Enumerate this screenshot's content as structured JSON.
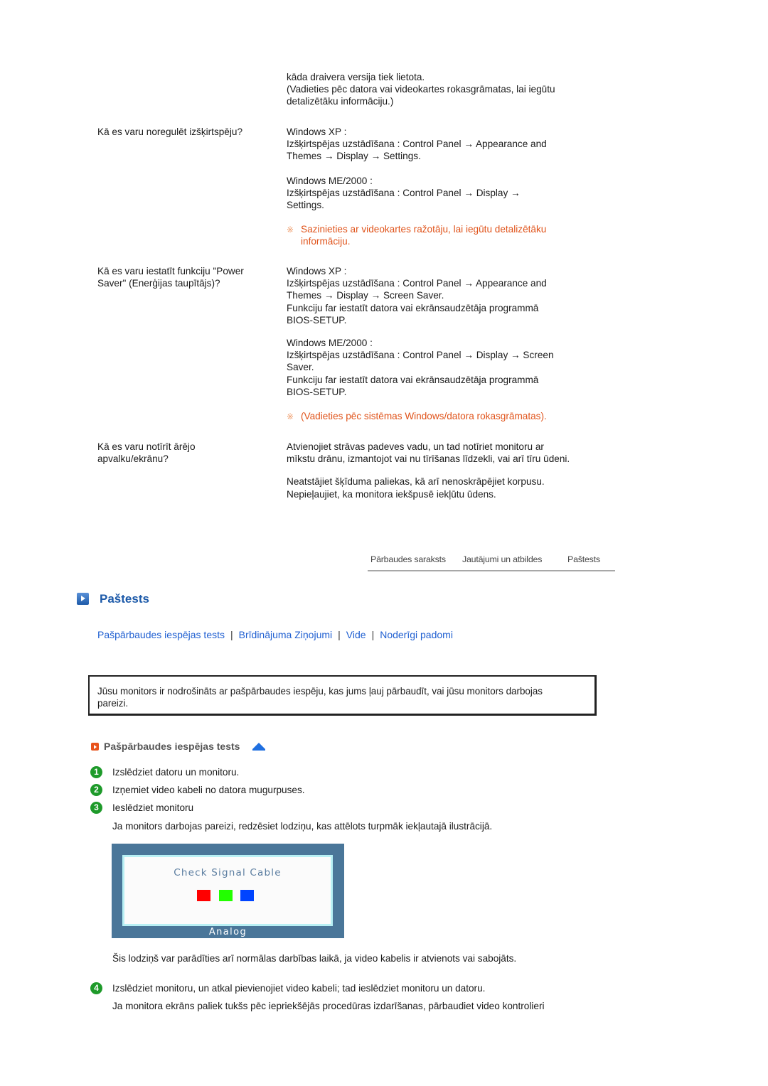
{
  "faq": {
    "intro_lines": [
      "kāda draivera versija tiek lietota.",
      "(Vadieties pēc datora vai videokartes rokasgrāmatas, lai iegūtu",
      "detalizētāku informāciju.)"
    ],
    "items": [
      {
        "question": "Kā es varu noregulēt izšķirtspēju?",
        "xp_label": "Windows XP :",
        "xp_lines": [
          "Izšķirtspējas uzstādīšana : Control Panel → Appearance and",
          "Themes → Display → Settings."
        ],
        "me_label": "Windows ME/2000 :",
        "me_lines": [
          "Izšķirtspējas uzstādīšana : Control Panel → Display →",
          "Settings."
        ],
        "note": "Sazinieties ar videokartes ražotāju, lai iegūtu detalizētāku informāciju."
      },
      {
        "question": "Kā es varu iestatīt funkciju \"Power Saver\" (Enerģijas taupītājs)?",
        "xp_label": "Windows XP :",
        "xp_lines": [
          "Izšķirtspējas uzstādīšana : Control Panel → Appearance and",
          "Themes → Display → Screen Saver.",
          "Funkciju far iestatīt datora vai ekrānsaudzētāja programmā",
          "BIOS-SETUP."
        ],
        "me_label": "Windows ME/2000 :",
        "me_lines": [
          "Izšķirtspējas uzstādīšana : Control Panel → Display → Screen",
          "Saver.",
          "Funkciju far iestatīt datora vai ekrānsaudzētāja programmā",
          "BIOS-SETUP."
        ],
        "note": "(Vadieties pēc sistēmas Windows/datora rokasgrāmatas)."
      },
      {
        "question": "Kā es varu notīrīt ārējo apvalku/ekrānu?",
        "answer_p1": "Atvienojiet strāvas padeves vadu, un tad notīriet monitoru ar mīkstu drānu, izmantojot vai nu tīrīšanas līdzekli, vai arī tīru ūdeni.",
        "answer_p2_lines": [
          "Neatstājiet šķīduma paliekas, kā arī nenoskrāpējiet korpusu.",
          "Nepieļaujiet, ka monitora iekšpusē iekļūtu ūdens."
        ]
      }
    ],
    "note_mark": "※"
  },
  "nav_tabs": [
    "Pārbaudes saraksts",
    "Jautājumi un atbildes",
    "Paštests"
  ],
  "section": {
    "title": "Paštests",
    "links": [
      "Pašpārbaudes iespējas tests",
      "Brīdinājuma Ziņojumi",
      "Vide",
      "Noderīgi padomi"
    ],
    "link_separator": "|",
    "info_text": "Jūsu monitors ir nodrošināts ar pašpārbaudes iespēju, kas jums ļauj pārbaudīt, vai jūsu monitors darbojas pareizi.",
    "subsection_title": "Pašpārbaudes iespējas tests",
    "steps": [
      {
        "num": "1",
        "text": "Izslēdziet datoru un monitoru."
      },
      {
        "num": "2",
        "text": "Izņemiet video kabeli no datora mugurpuses."
      },
      {
        "num": "3",
        "text": "Ieslēdziet monitoru"
      }
    ],
    "step3_detail": "Ja monitors darbojas pareizi, redzēsiet lodziņu, kas attēlots turpmāk iekļautajā ilustrācijā.",
    "osd": {
      "message": "Check Signal Cable",
      "mode": "Analog",
      "colors": [
        "#ff0000",
        "#22ff00",
        "#0044ff"
      ]
    },
    "after_osd": "Šis lodziņš var parādīties arī normālas darbības laikā, ja video kabelis ir atvienots vai sabojāts.",
    "step4": {
      "num": "4",
      "text": "Izslēdziet monitoru, un atkal pievienojiet video kabeli; tad ieslēdziet monitoru un datoru."
    },
    "step4_detail": "Ja monitora ekrāns paliek tukšs pēc iepriekšējās procedūras izdarīšanas, pārbaudiet video kontrolieri"
  }
}
